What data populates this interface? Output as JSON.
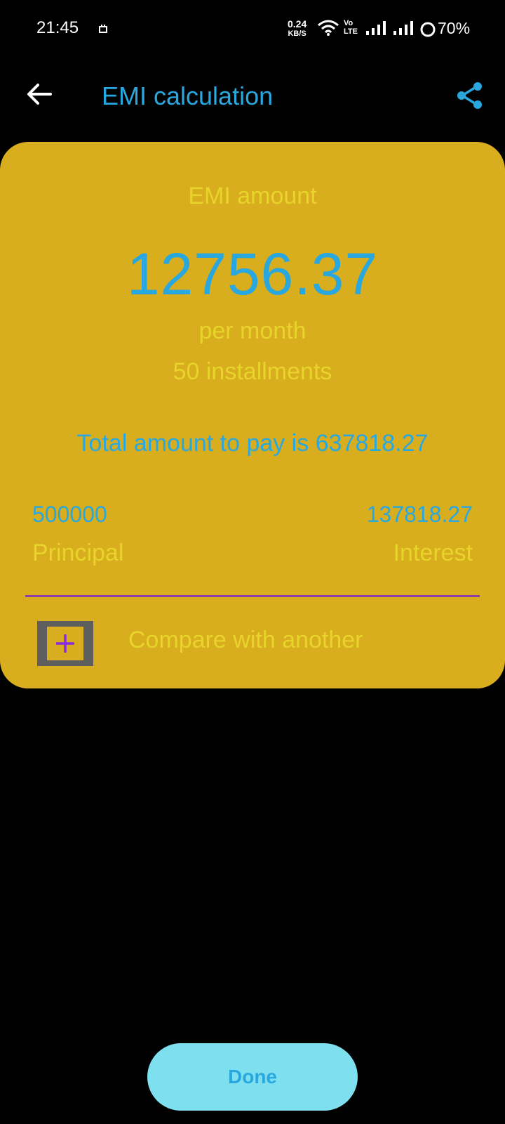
{
  "status_bar": {
    "time": "21:45",
    "net_speed": "0.24",
    "net_speed_unit": "KB/S",
    "volte": "VoLTE",
    "battery": "70%"
  },
  "app_bar": {
    "title": "EMI calculation",
    "back_icon": "arrow-left-icon",
    "share_icon": "share-icon"
  },
  "result": {
    "emi_label": "EMI amount",
    "emi_value": "12756.37",
    "per_month": "per month",
    "installments": "50 installments",
    "total_text": "Total amount to pay is 637818.27",
    "principal_value": "500000",
    "principal_label": "Principal",
    "interest_value": "137818.27",
    "interest_label": "Interest",
    "compare_label": "Compare with another"
  },
  "actions": {
    "done_label": "Done"
  },
  "colors": {
    "background": "#000000",
    "card": "#d8ad1e",
    "accent_blue": "#29a8e0",
    "label_yellow": "#e8d42a",
    "divider_purple": "#8a3fa8",
    "done_button": "#7ee0ee"
  }
}
